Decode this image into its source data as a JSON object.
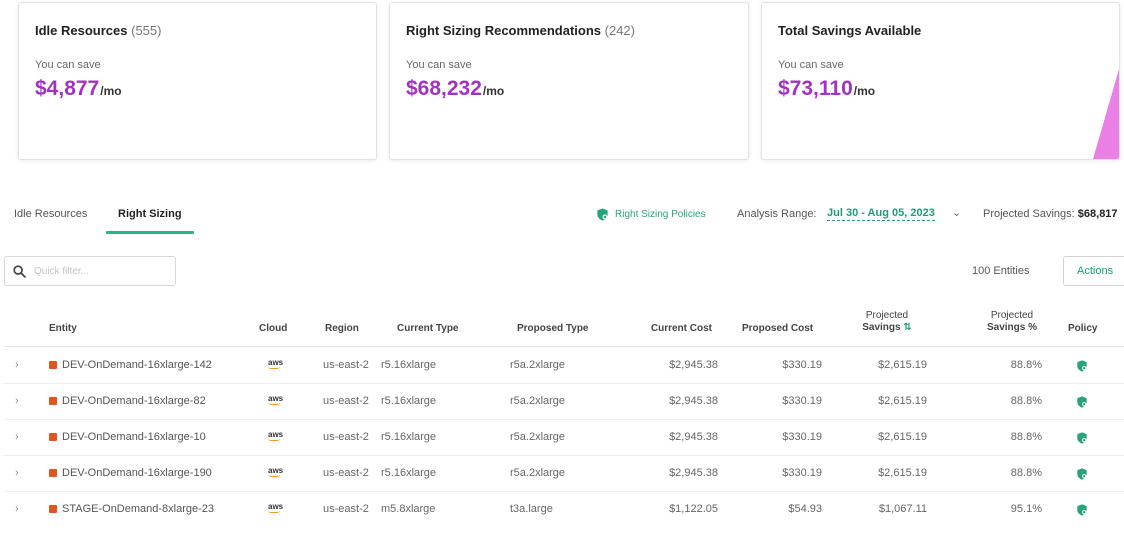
{
  "cards": [
    {
      "title": "Idle Resources",
      "count": "(555)",
      "subtitle": "You can save",
      "amount": "$4,877",
      "unit": "/mo"
    },
    {
      "title": "Right Sizing Recommendations",
      "count": "(242)",
      "subtitle": "You can save",
      "amount": "$68,232",
      "unit": "/mo"
    },
    {
      "title": "Total Savings Available",
      "count": "",
      "subtitle": "You can save",
      "amount": "$73,110",
      "unit": "/mo"
    }
  ],
  "tabs": [
    {
      "label": "Idle Resources",
      "active": false
    },
    {
      "label": "Right Sizing",
      "active": true
    }
  ],
  "toolbar": {
    "policies_label": "Right Sizing Policies",
    "analysis_range_label": "Analysis Range:",
    "analysis_range_value": "Jul 30 - Aug 05, 2023",
    "projected_label": "Projected Savings:",
    "projected_value": "$68,817"
  },
  "search": {
    "placeholder": "Quick filter..."
  },
  "entities_count": "100 Entities",
  "actions_label": "Actions",
  "table": {
    "columns": {
      "entity": "Entity",
      "cloud": "Cloud",
      "region": "Region",
      "current_type": "Current Type",
      "proposed_type": "Proposed Type",
      "current_cost": "Current Cost",
      "proposed_cost": "Proposed Cost",
      "projected_savings_1": "Projected",
      "projected_savings_2": "Savings",
      "projected_pct_1": "Projected",
      "projected_pct_2": "Savings %",
      "policy": "Policy"
    },
    "rows": [
      {
        "entity": "DEV-OnDemand-16xlarge-142",
        "cloud": "aws",
        "region": "us-east-2",
        "current_type": "r5.16xlarge",
        "proposed_type": "r5a.2xlarge",
        "current_cost": "$2,945.38",
        "proposed_cost": "$330.19",
        "savings": "$2,615.19",
        "savings_pct": "88.8%"
      },
      {
        "entity": "DEV-OnDemand-16xlarge-82",
        "cloud": "aws",
        "region": "us-east-2",
        "current_type": "r5.16xlarge",
        "proposed_type": "r5a.2xlarge",
        "current_cost": "$2,945.38",
        "proposed_cost": "$330.19",
        "savings": "$2,615.19",
        "savings_pct": "88.8%"
      },
      {
        "entity": "DEV-OnDemand-16xlarge-10",
        "cloud": "aws",
        "region": "us-east-2",
        "current_type": "r5.16xlarge",
        "proposed_type": "r5a.2xlarge",
        "current_cost": "$2,945.38",
        "proposed_cost": "$330.19",
        "savings": "$2,615.19",
        "savings_pct": "88.8%"
      },
      {
        "entity": "DEV-OnDemand-16xlarge-190",
        "cloud": "aws",
        "region": "us-east-2",
        "current_type": "r5.16xlarge",
        "proposed_type": "r5a.2xlarge",
        "current_cost": "$2,945.38",
        "proposed_cost": "$330.19",
        "savings": "$2,615.19",
        "savings_pct": "88.8%"
      },
      {
        "entity": "STAGE-OnDemand-8xlarge-23",
        "cloud": "aws",
        "region": "us-east-2",
        "current_type": "m5.8xlarge",
        "proposed_type": "t3a.large",
        "current_cost": "$1,122.05",
        "proposed_cost": "$54.93",
        "savings": "$1,067.11",
        "savings_pct": "95.1%"
      }
    ]
  },
  "colors": {
    "accent": "#29b58a",
    "amount": "#a233c2",
    "entity_marker": "#e2561e",
    "aws_smile": "#f19a2a"
  }
}
